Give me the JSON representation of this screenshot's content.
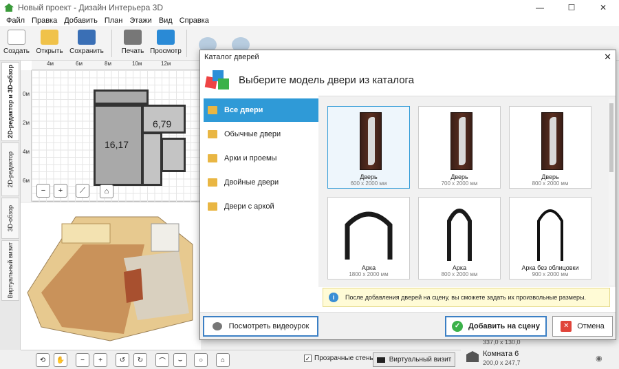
{
  "window": {
    "title": "Новый проект - Дизайн Интерьера 3D",
    "minimize": "—",
    "maximize": "☐",
    "close": "✕"
  },
  "menu": [
    "Файл",
    "Правка",
    "Добавить",
    "План",
    "Этажи",
    "Вид",
    "Справка"
  ],
  "toolbar": {
    "create": "Создать",
    "open": "Открыть",
    "save": "Сохранить",
    "print": "Печать",
    "preview": "Просмотр"
  },
  "sidetabs": [
    "2D-редактор и 3D-обзор",
    "2D-редактор",
    "3D-обзор",
    "Виртуальный визит"
  ],
  "plan": {
    "ruler_top": [
      "4м",
      "6м",
      "8м",
      "10м",
      "12м"
    ],
    "ruler_left": [
      "0м",
      "2м",
      "4м",
      "6м"
    ],
    "room1": "16,17",
    "room2": "6,79"
  },
  "bottom": {
    "transparent_walls": "Прозрачные стены",
    "virtual_visit": "Виртуальный визит"
  },
  "rightpanel": {
    "dim1": "337,0 x 130,0",
    "room_name": "Комната 6",
    "room_dims": "200,0 x 247,7"
  },
  "dialog": {
    "title": "Каталог дверей",
    "heading": "Выберите модель двери из каталога",
    "categories": [
      "Все двери",
      "Обычные двери",
      "Арки и проемы",
      "Двойные двери",
      "Двери с аркой"
    ],
    "items": [
      {
        "name": "Дверь",
        "size": "600 x 2000 мм"
      },
      {
        "name": "Дверь",
        "size": "700 x 2000 мм"
      },
      {
        "name": "Дверь",
        "size": "800 x 2000 мм"
      },
      {
        "name": "Арка",
        "size": "1800 x 2000 мм"
      },
      {
        "name": "Арка",
        "size": "800 x 2000 мм"
      },
      {
        "name": "Арка без облицовки",
        "size": "900 x 2000 мм"
      }
    ],
    "info": "После добавления дверей на сцену, вы сможете задать их произвольные размеры.",
    "video_btn": "Посмотреть видеоурок",
    "add_btn": "Добавить на сцену",
    "cancel_btn": "Отмена"
  }
}
